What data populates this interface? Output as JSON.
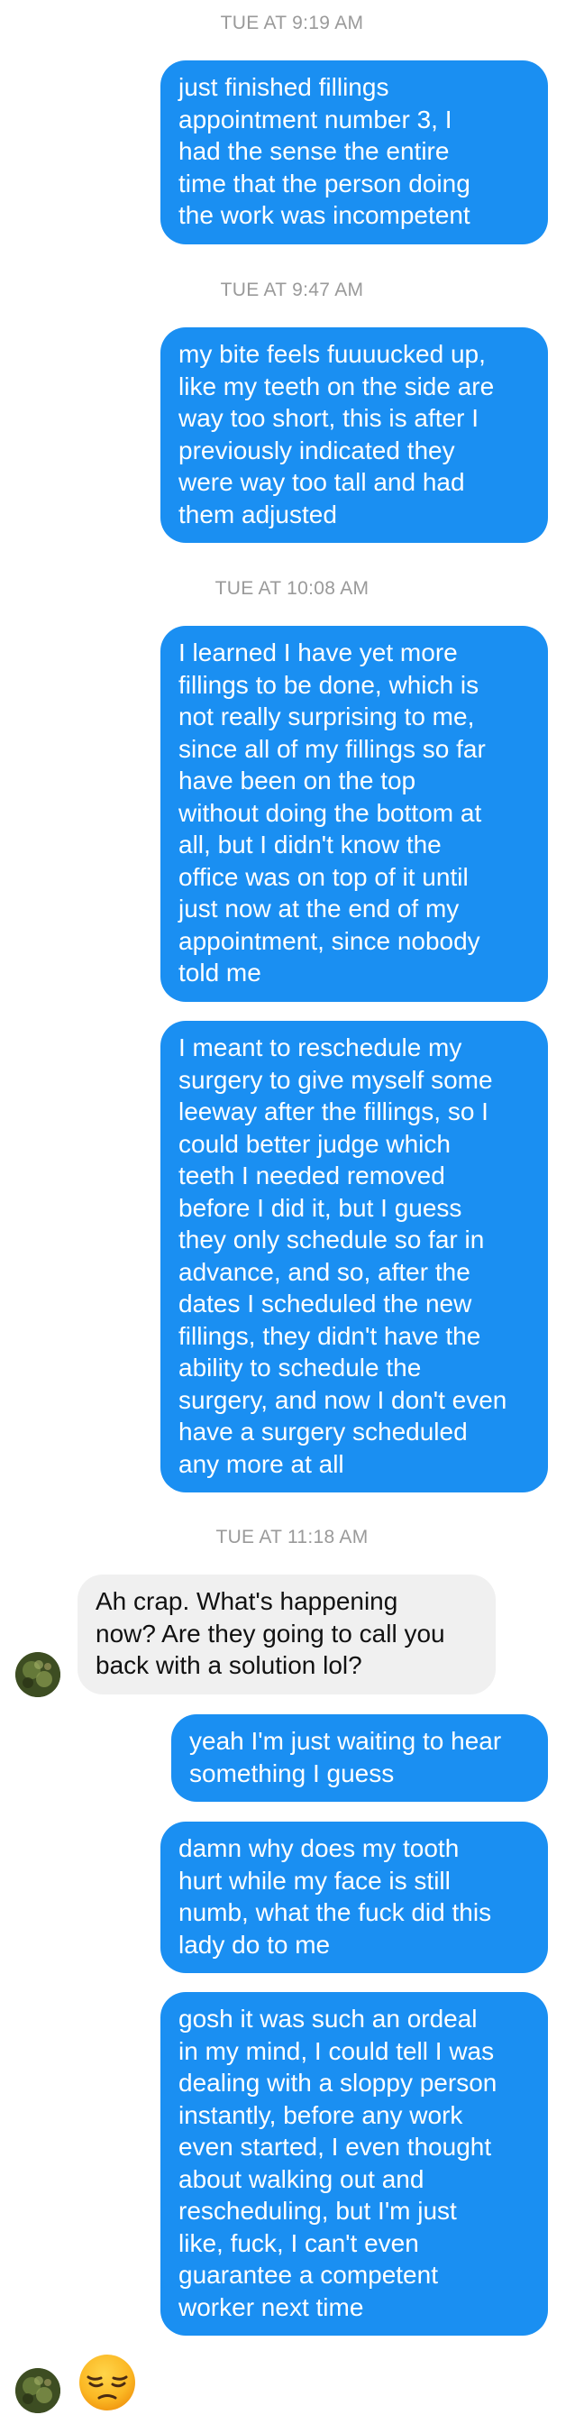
{
  "thread": {
    "timestamps": {
      "t1": "TUE AT 9:19 AM",
      "t2": "TUE AT 9:47 AM",
      "t3": "TUE AT 10:08 AM",
      "t4": "TUE AT 11:18 AM"
    },
    "messages": {
      "m1": "just finished fillings\nappointment number 3, I\nhad the sense the entire\ntime that the person doing\nthe work was incompetent",
      "m2": "my bite feels fuuuucked up,\nlike my teeth on the side are\nway too short, this is after I\npreviously indicated they\nwere way too tall and had\nthem adjusted",
      "m3": "I learned I have yet more\nfillings to be done, which is\nnot really surprising to me,\nsince all of my fillings so far\nhave been on the top\nwithout doing the bottom at\nall, but I didn't know the\noffice was on top of it until\njust now at the end of my\nappointment, since nobody\ntold me",
      "m4": "I meant to reschedule my\nsurgery to give myself some\nleeway after the fillings, so I\ncould better judge which\nteeth I needed removed\nbefore I did it, but I guess\nthey only schedule so far in\nadvance, and so, after the\ndates I scheduled the new\nfillings, they didn't have the\nability to schedule the\nsurgery, and now I don't even\nhave a surgery scheduled\nany more at all",
      "m5": "Ah crap. What's happening\nnow? Are they going to call you\nback with a solution lol?",
      "m6": "yeah I'm just waiting to hear\nsomething I guess",
      "m7": "damn why does my tooth\nhurt while my face is still\nnumb, what the fuck did this\nlady do to me",
      "m8": "gosh it was such an ordeal\nin my mind, I could tell I was\ndealing with a sloppy person\ninstantly, before any work\neven started, I even thought\nabout walking out and\nrescheduling, but I'm just\nlike, fuck, I can't even\nguarantee a competent\nworker next time"
    },
    "reaction": {
      "icon": "pensive-face-emoji"
    }
  },
  "colors": {
    "outgoing_bubble": "#1a8ff2",
    "incoming_bubble": "#f0f0f0",
    "timestamp_text": "#9a9a9a"
  }
}
